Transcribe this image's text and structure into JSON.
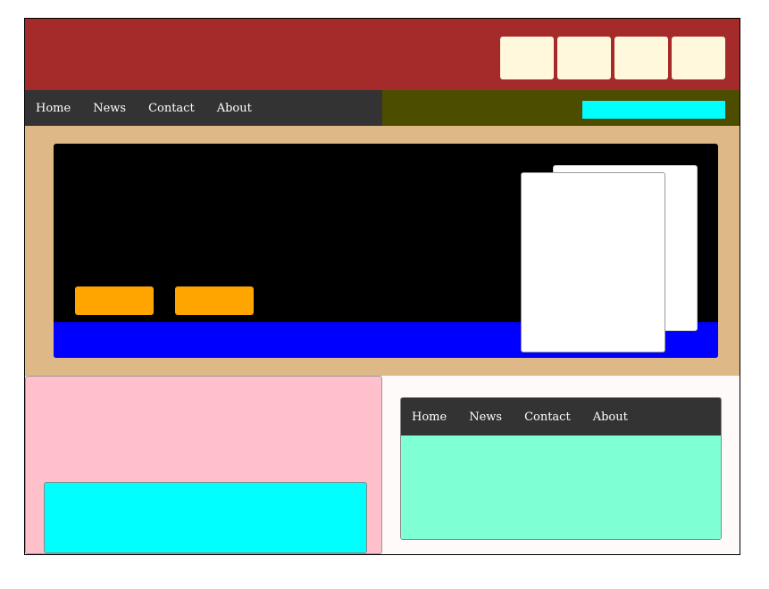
{
  "colors": {
    "header_bg": "#a52a2a",
    "header_tile": "#fff8dc",
    "nav_bg": "#333333",
    "nav_right_bg": "#4d4d00",
    "nav_search": "#00ffff",
    "hero_section_bg": "#deb887",
    "hero_bg": "#000000",
    "hero_band": "#0000ff",
    "hero_button": "#ffa500",
    "card": "#ffffff",
    "panel_left_bg": "#ffc0cb",
    "panel_left_box": "#00ffff",
    "panel_right_bg": "#fffafa",
    "inner_nav_bg": "#333333",
    "inner_body_bg": "#7fffd4"
  },
  "header": {
    "tiles": [
      "",
      "",
      "",
      ""
    ]
  },
  "nav": {
    "items": [
      {
        "label": "Home"
      },
      {
        "label": "News"
      },
      {
        "label": "Contact"
      },
      {
        "label": "About"
      }
    ],
    "search": {
      "value": "",
      "placeholder": ""
    }
  },
  "hero": {
    "buttons": [
      {
        "label": ""
      },
      {
        "label": ""
      }
    ]
  },
  "inner_card": {
    "nav_items": [
      {
        "label": "Home"
      },
      {
        "label": "News"
      },
      {
        "label": "Contact"
      },
      {
        "label": "About"
      }
    ]
  }
}
